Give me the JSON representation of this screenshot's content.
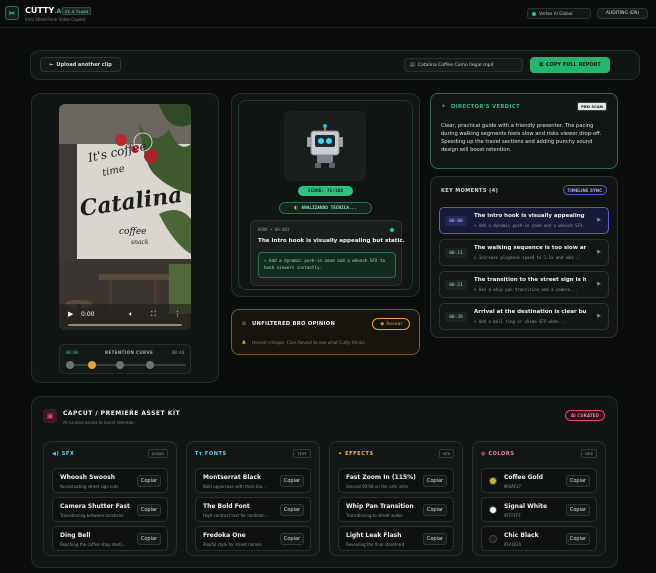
{
  "app": {
    "name": "CUTTY",
    "name_suffix": ".AI",
    "version_badge": "V3.5 FLASH",
    "tagline": "Viral Short-Form Video Copilot",
    "region": "Vertex AI Global",
    "auditing_label": "AUDITING (EN)"
  },
  "toolbar": {
    "upload_label": "Upload another clip",
    "file_name": "Catalina Coffee Como llegar.mp4",
    "copy_report_label": "COPY FULL REPORT"
  },
  "player": {
    "time": "0:00",
    "retention_label": "RETENTION CURVE",
    "retention_start": "00:00",
    "retention_end": "00:48",
    "retention_marker_fraction": 0.22
  },
  "analysis": {
    "score": "SCORE: 72/100",
    "status": "ANALIZANDO TÉCNICA...",
    "hook_label": "HOOK • 00:001",
    "hook_title": "The intro hook is visually appealing but static.",
    "hook_fix": "✎ Add a dynamic push-in zoom and a whoosh SFX to hook viewers instantly."
  },
  "opinion": {
    "title": "UNFILTERED BRO OPINION",
    "reveal_label": "Reveal",
    "text": "Honest critique. Click Reveal to see what Cutty thinks."
  },
  "verdict": {
    "title": "DIRECTOR'S VERDICT",
    "badge": "PRO SCAN",
    "text": "Clear, practical guide with a friendly presenter. The pacing during walking segments feels slow and risks viewer drop-off. Speeding up the travel sections and adding punchy sound design will boost retention."
  },
  "moments": {
    "title": "KEY MOMENTS (4)",
    "badge": "TIMELINE SYNC",
    "items": [
      {
        "time": "00:00",
        "title": "The intro hook is visually appealing but...",
        "sub": "✎ Add a dynamic push-in zoom and a whoosh SFX..."
      },
      {
        "time": "00:11",
        "title": "The walking sequence is too slow and lac...",
        "sub": "✎ Increase playback speed to 1.5x and add..."
      },
      {
        "time": "00:21",
        "title": "The transition to the street sign is helpful...",
        "sub": "✎ Use a whip pan transition and a camera..."
      },
      {
        "time": "00:39",
        "title": "Arrival at the destination is clear but nee...",
        "sub": "✎ Add a bell ring or chime SFX when..."
      }
    ]
  },
  "kit": {
    "title": "CAPCUT / PREMIERE ASSET KIT",
    "subtitle": "AI curated assets to boost retention",
    "badge": "AI CURATED",
    "copy_label": "Copiar",
    "columns": [
      {
        "title": "SFX",
        "badge": "AUDIO",
        "color": "#5fd3f0",
        "items": [
          {
            "name": "Whoosh Swoosh",
            "sub": "Accentuating street sign cuts"
          },
          {
            "name": "Camera Shutter Fast",
            "sub": "Transitioning between locations"
          },
          {
            "name": "Ding Bell",
            "sub": "Reaching the coffee shop desti..."
          }
        ]
      },
      {
        "title": "FONTS",
        "badge": "TEXT",
        "color": "#5fd3f0",
        "items": [
          {
            "name": "Montserrat Black",
            "sub": "Bold uppercase with thick bla..."
          },
          {
            "name": "The Bold Font",
            "sub": "High-contrast text for landmar..."
          },
          {
            "name": "Fredoka One",
            "sub": "Playful style for street names"
          }
        ]
      },
      {
        "title": "EFFECTS",
        "badge": "VFX",
        "color": "#f2b84b",
        "items": [
          {
            "name": "Fast Zoom In (115%)",
            "sub": "Second 00:08 on the cafe intro"
          },
          {
            "name": "Whip Pan Transition",
            "sub": "Transitioning to street walks"
          },
          {
            "name": "Light Leak Flash",
            "sub": "Revealing the final storefront"
          }
        ]
      },
      {
        "title": "COLORS",
        "badge": "HEX",
        "color": "#f07fa0",
        "items": [
          {
            "name": "Coffee Gold",
            "sub": "#D4AF37",
            "swatch": "#D4AF37"
          },
          {
            "name": "Signal White",
            "sub": "#FFFFFF",
            "swatch": "#FFFFFF"
          },
          {
            "name": "Chic Black",
            "sub": "#1A1A1A",
            "swatch": "#1A1A1A"
          }
        ]
      }
    ]
  },
  "colors": {
    "accent_green": "#2ec27e",
    "accent_indigo": "#5b5bd6",
    "accent_orange": "#e8a33a",
    "accent_pink": "#e0447a"
  }
}
